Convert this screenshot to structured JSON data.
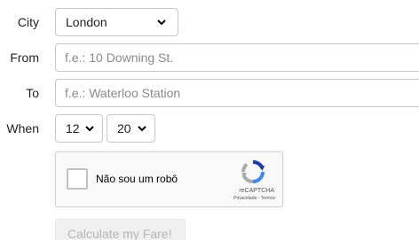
{
  "form": {
    "city": {
      "label": "City",
      "selected": "London"
    },
    "from": {
      "label": "From",
      "value": "",
      "placeholder": "f.e.: 10 Downing St."
    },
    "to": {
      "label": "To",
      "value": "",
      "placeholder": "f.e.: Waterloo Station"
    },
    "when": {
      "label": "When",
      "hour": "12",
      "minute": "20"
    },
    "recaptcha": {
      "checkbox_label": "Não sou um robô",
      "brand": "reCAPTCHA",
      "links": "Privacidade - Termos",
      "icon": "recaptcha-logo-icon"
    },
    "submit_label": "Calculate my Fare!"
  }
}
